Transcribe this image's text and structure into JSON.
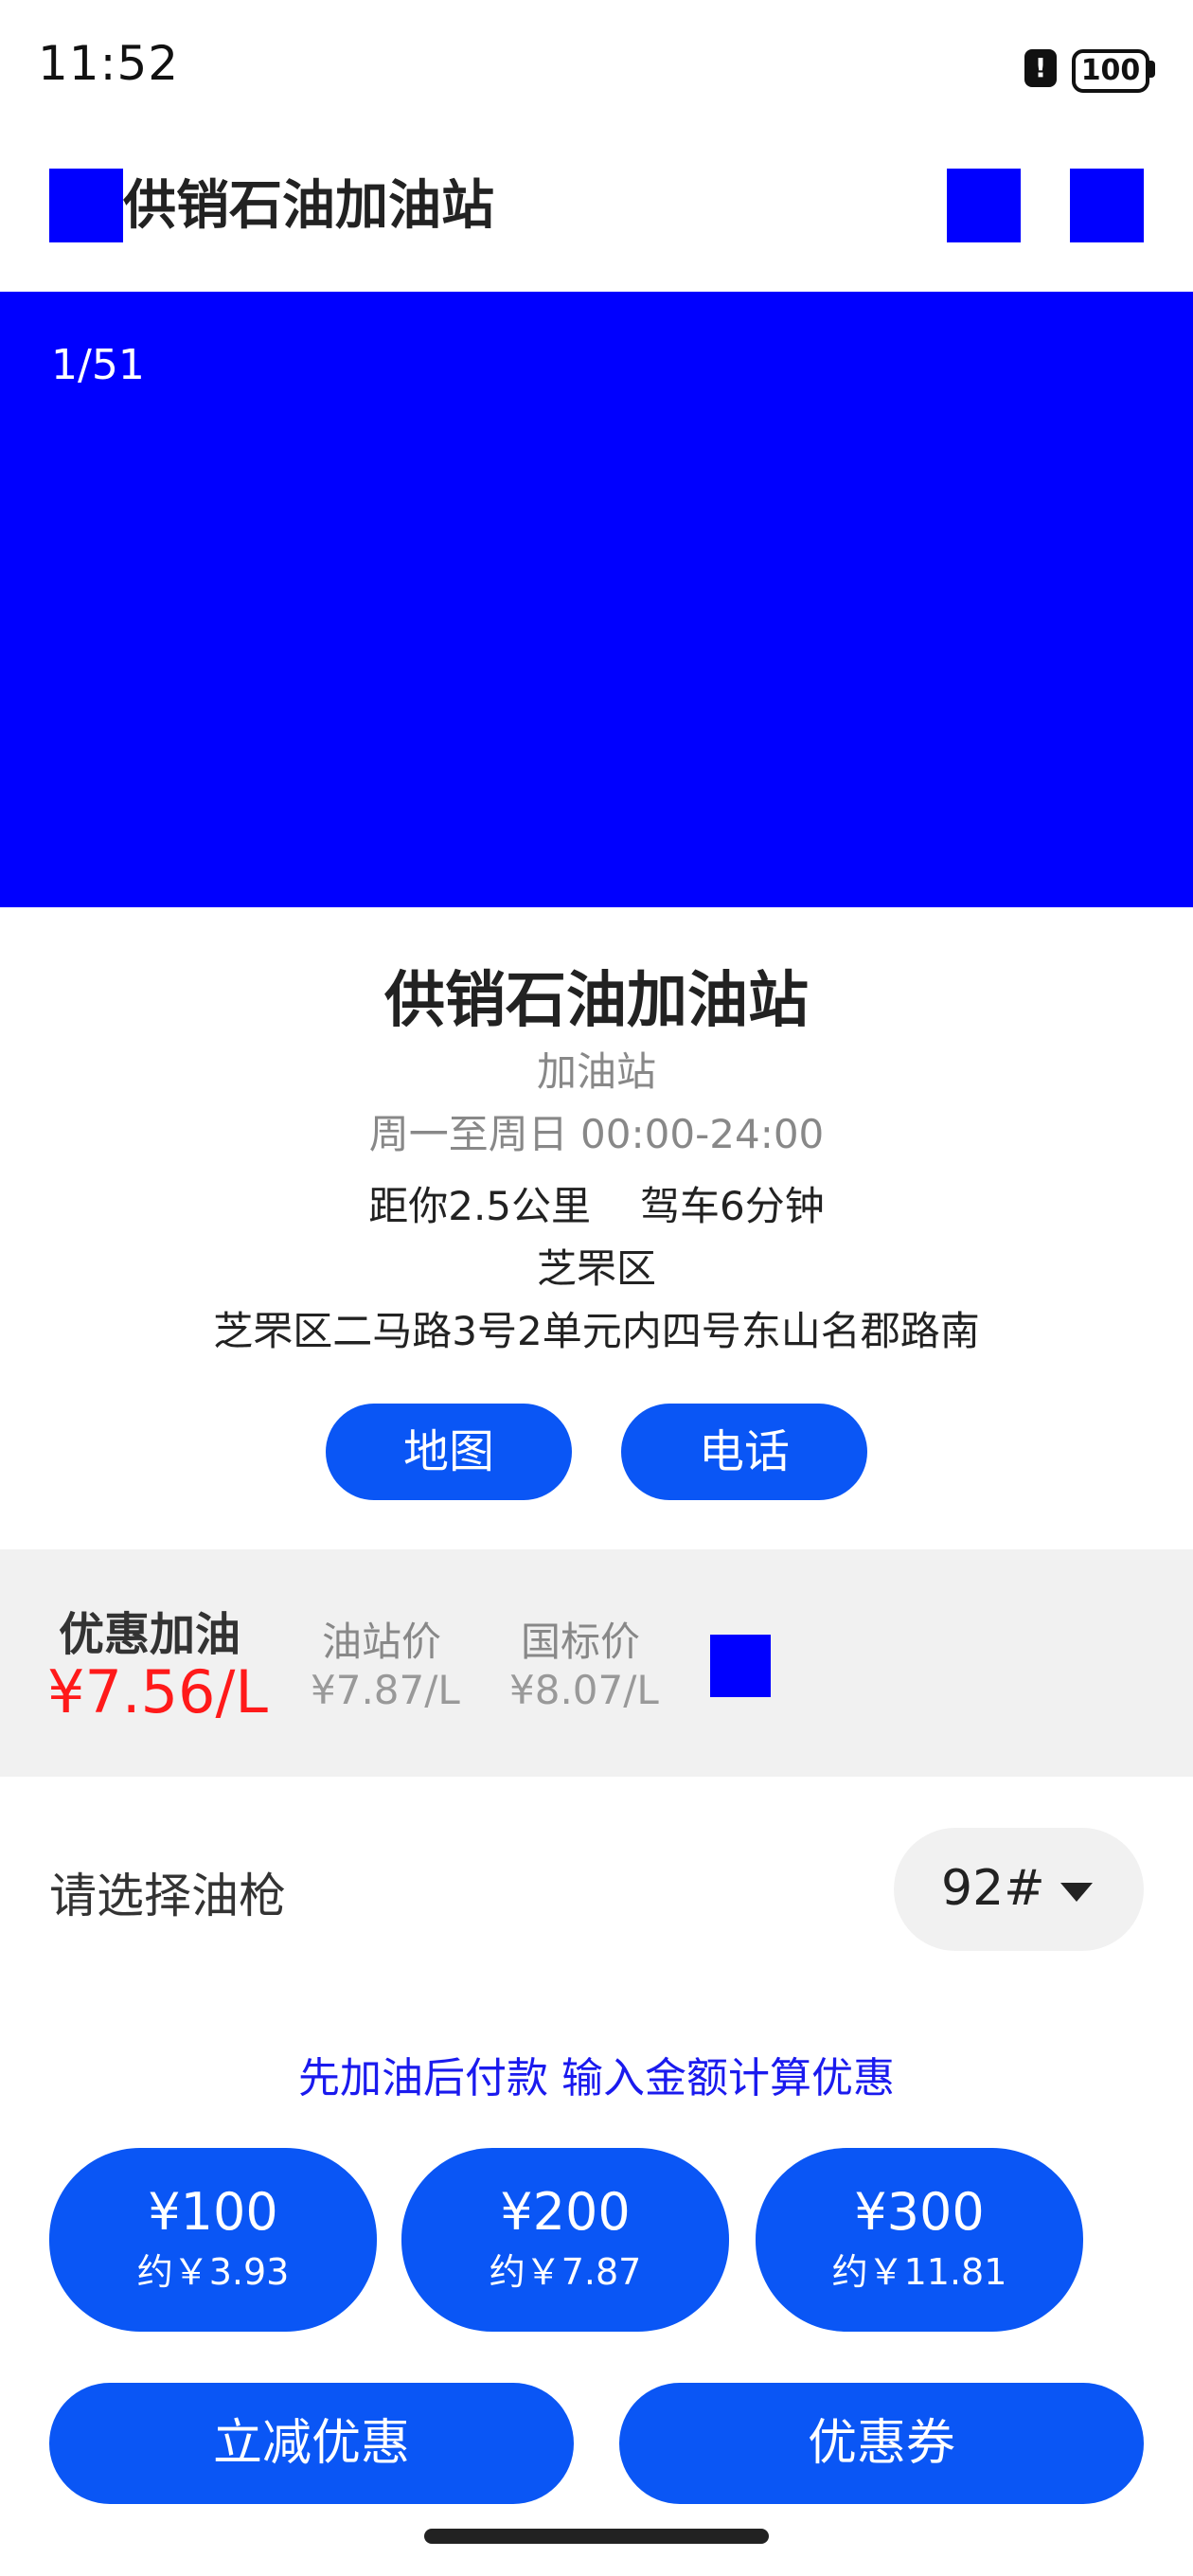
{
  "status_bar": {
    "time": "11:52",
    "alert_glyph": "!",
    "battery": "100"
  },
  "header": {
    "title": "供销石油加油站",
    "back_icon": "back-icon",
    "action_icons": [
      "share-icon",
      "more-icon"
    ]
  },
  "banner": {
    "counter": "1/51"
  },
  "station": {
    "name": "供销石油加油站",
    "type": "加油站",
    "hours": "周一至周日 00:00-24:00",
    "distance": "距你2.5公里",
    "drive_time": "驾车6分钟",
    "district": "芝罘区",
    "address": "芝罘区二马路3号2单元内四号东山名郡路南"
  },
  "actions": {
    "map_label": "地图",
    "phone_label": "电话"
  },
  "prices": {
    "discount_label": "优惠加油",
    "discount_value": "¥7.56/L",
    "station_label": "油站价",
    "station_value": "¥7.87/L",
    "national_label": "国标价",
    "national_value": "¥8.07/L",
    "info_icon": "info-icon"
  },
  "gun": {
    "label": "请选择油枪",
    "selected": "92#"
  },
  "promo": {
    "text": "先加油后付款 输入金额计算优惠"
  },
  "amounts": [
    {
      "amount": "¥100",
      "approx": "约￥3.93"
    },
    {
      "amount": "¥200",
      "approx": "约￥7.87"
    },
    {
      "amount": "¥300",
      "approx": "约￥11.81"
    }
  ],
  "footer": {
    "discount_label": "立减优惠",
    "coupon_label": "优惠券"
  },
  "colors": {
    "accent": "#0a56f5",
    "price_red": "#ff1a1a",
    "placeholder_blue": "#0000ff"
  }
}
